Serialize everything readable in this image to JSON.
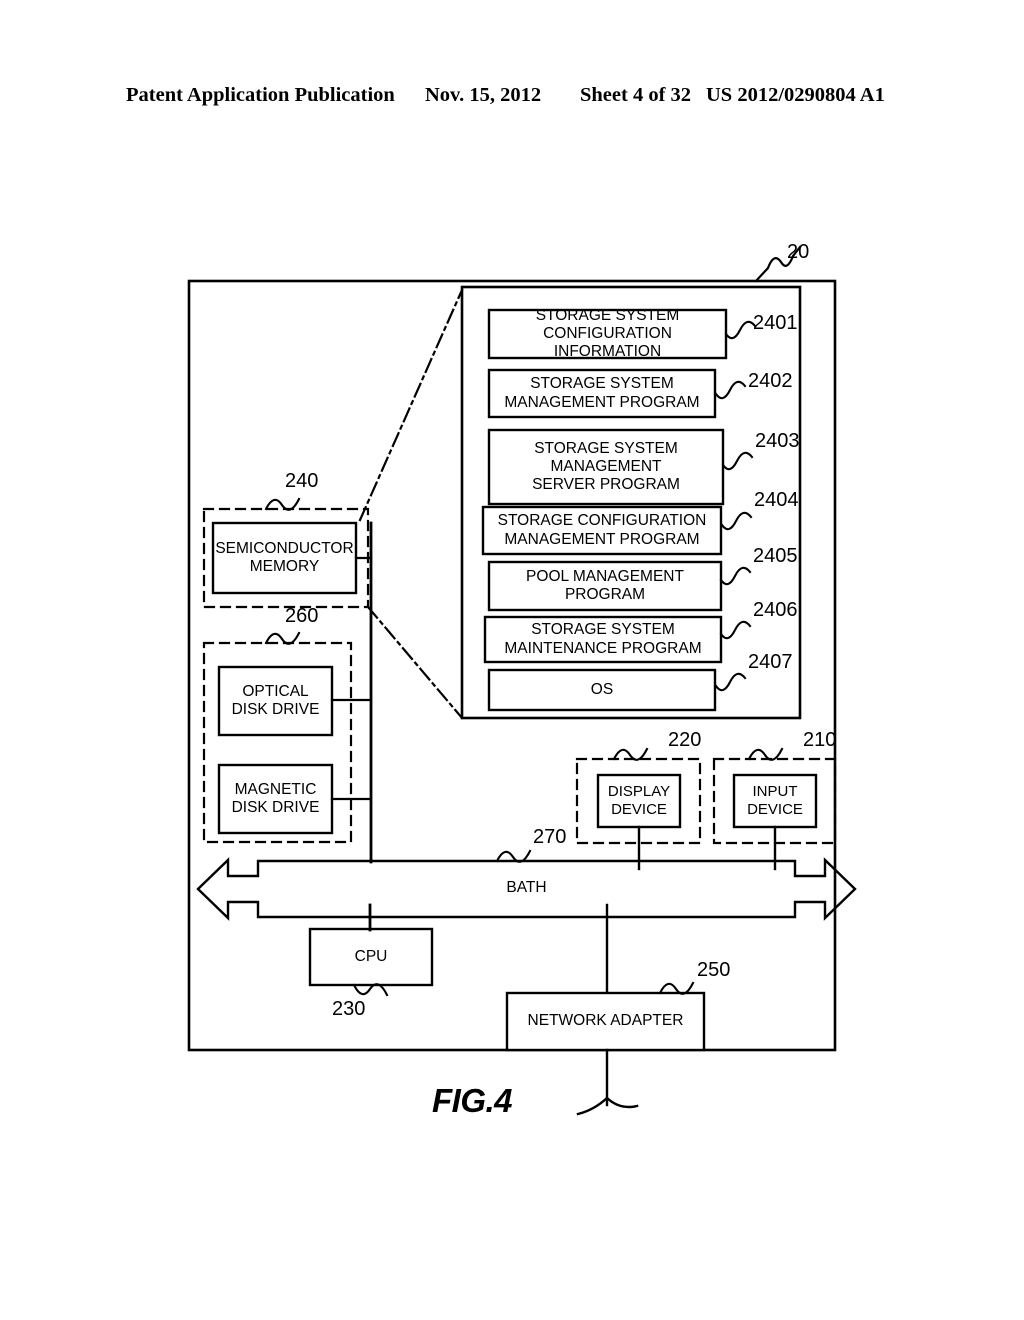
{
  "header": {
    "publication": "Patent Application Publication",
    "date": "Nov. 15, 2012",
    "sheet": "Sheet 4 of 32",
    "patent_number": "US 2012/0290804 A1"
  },
  "figure": {
    "caption": "FIG.4",
    "system_ref": "20"
  },
  "memory_detail": {
    "boxes": [
      {
        "label": "STORAGE SYSTEM\nCONFIGURATION INFORMATION",
        "ref": "2401"
      },
      {
        "label": "STORAGE SYSTEM\nMANAGEMENT PROGRAM",
        "ref": "2402"
      },
      {
        "label": "STORAGE SYSTEM\nMANAGEMENT\nSERVER PROGRAM",
        "ref": "2403"
      },
      {
        "label": "STORAGE CONFIGURATION\nMANAGEMENT PROGRAM",
        "ref": "2404"
      },
      {
        "label": "POOL MANAGEMENT\nPROGRAM",
        "ref": "2405"
      },
      {
        "label": "STORAGE SYSTEM\nMAINTENANCE PROGRAM",
        "ref": "2406"
      },
      {
        "label": "OS",
        "ref": "2407"
      }
    ]
  },
  "components": {
    "semiconductor_memory": {
      "label": "SEMICONDUCTOR\nMEMORY",
      "ref": "240"
    },
    "drive_group": {
      "ref": "260"
    },
    "optical_disk_drive": {
      "label": "OPTICAL\nDISK DRIVE"
    },
    "magnetic_disk_drive": {
      "label": "MAGNETIC\nDISK DRIVE"
    },
    "display_device": {
      "label": "DISPLAY\nDEVICE",
      "ref": "220"
    },
    "input_device": {
      "label": "INPUT\nDEVICE",
      "ref": "210"
    },
    "bus": {
      "label": "BATH",
      "ref": "270"
    },
    "cpu": {
      "label": "CPU",
      "ref": "230"
    },
    "network_adapter": {
      "label": "NETWORK ADAPTER",
      "ref": "250"
    }
  },
  "colors": {
    "line": "#000000",
    "background": "#ffffff"
  }
}
